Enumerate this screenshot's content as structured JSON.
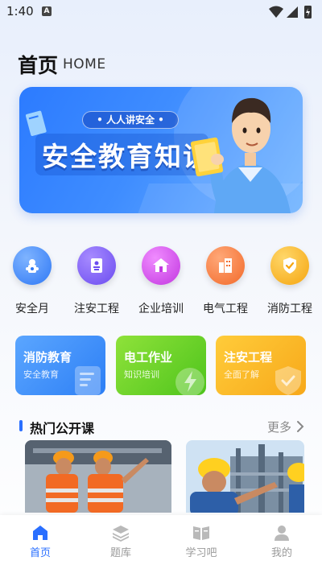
{
  "status_bar": {
    "time": "1:40",
    "notification_glyph": "A"
  },
  "header": {
    "title": "首页",
    "subtitle": "HOME"
  },
  "banner": {
    "pill_text": "• 人人讲安全 •",
    "title": "安全教育知识"
  },
  "categories": [
    {
      "label": "安全月",
      "icon": "fire-hydrant-icon",
      "color": "#3a86ff"
    },
    {
      "label": "注安工程",
      "icon": "id-card-icon",
      "color": "#7b5cff"
    },
    {
      "label": "企业培训",
      "icon": "house-icon",
      "color": "#d04df0"
    },
    {
      "label": "电气工程",
      "icon": "building-icon",
      "color": "#ff7a3c"
    },
    {
      "label": "消防工程",
      "icon": "shield-check-icon",
      "color": "#ffb21c"
    }
  ],
  "feature_cards": [
    {
      "title": "消防教育",
      "subtitle": "安全教育",
      "icon": "document-icon"
    },
    {
      "title": "电工作业",
      "subtitle": "知识培训",
      "icon": "lightning-icon"
    },
    {
      "title": "注安工程",
      "subtitle": "全面了解",
      "icon": "shield-icon"
    }
  ],
  "section": {
    "title": "热门公开课",
    "more": "更多"
  },
  "bottom_nav": [
    {
      "label": "首页",
      "icon": "home-icon",
      "active": true
    },
    {
      "label": "题库",
      "icon": "layers-icon",
      "active": false
    },
    {
      "label": "学习吧",
      "icon": "book-icon",
      "active": false
    },
    {
      "label": "我的",
      "icon": "user-icon",
      "active": false
    }
  ],
  "colors": {
    "accent": "#2a6fff",
    "inactive": "#9a9a9a"
  }
}
